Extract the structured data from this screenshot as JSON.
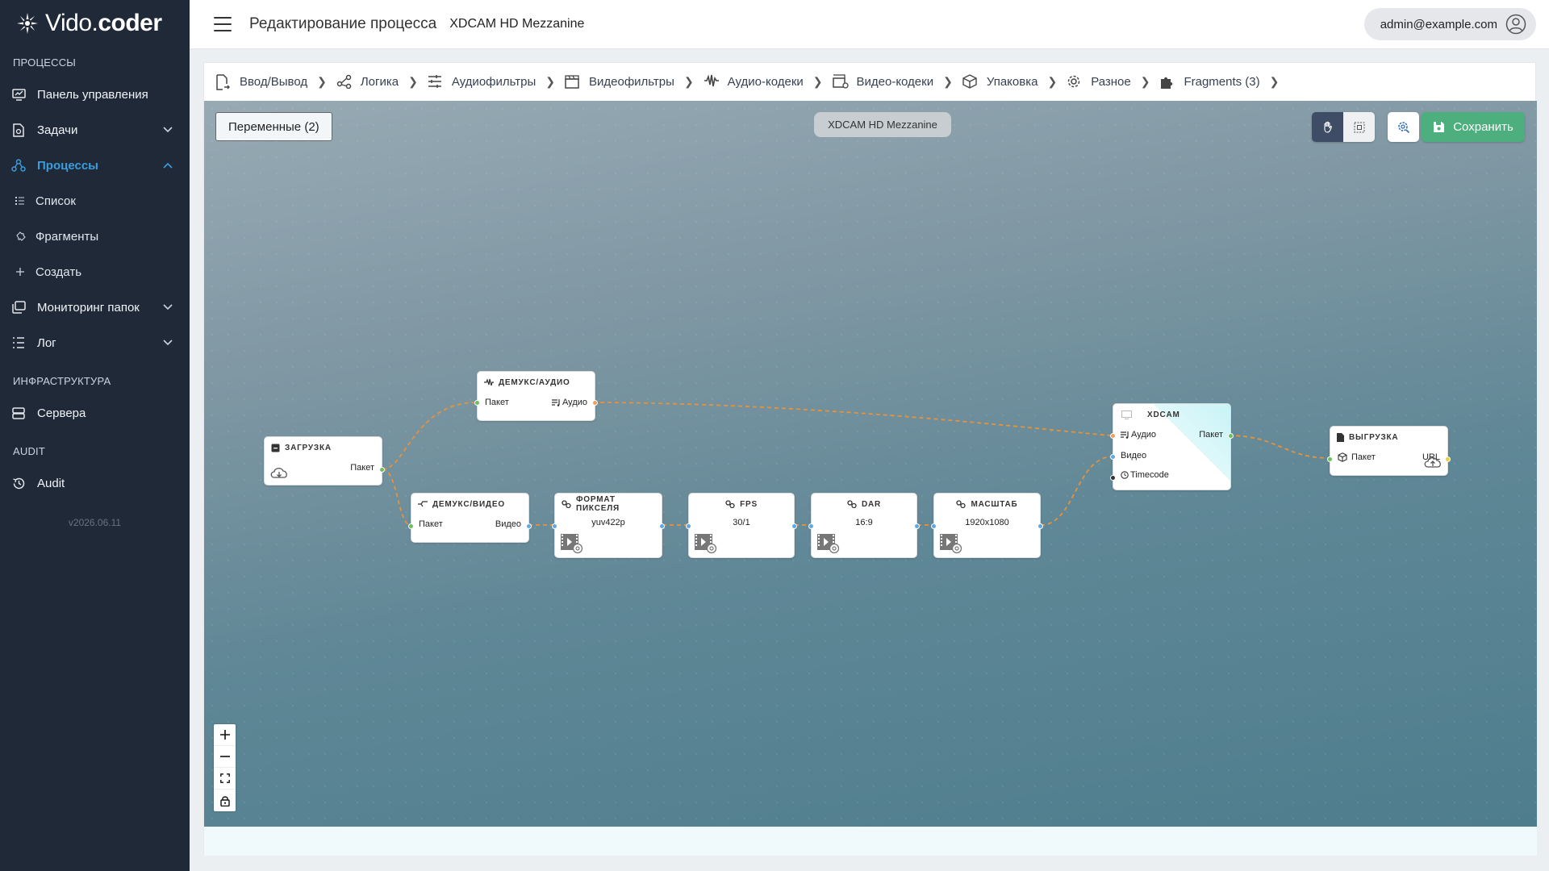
{
  "app": {
    "logo_light": "Vido.",
    "logo_bold": "coder",
    "version": "v2026.06.11"
  },
  "sidebar": {
    "section_processes": "ПРОЦЕССЫ",
    "dashboard": "Панель управления",
    "tasks": "Задачи",
    "processes": "Процессы",
    "list": "Список",
    "fragments": "Фрагменты",
    "create": "Создать",
    "folder_monitoring": "Мониторинг папок",
    "log": "Лог",
    "section_infra": "ИНФРАСТРУКТУРА",
    "servers": "Сервера",
    "section_audit": "AUDIT",
    "audit": "Audit"
  },
  "header": {
    "title": "Редактирование процесса",
    "subtitle": "XDCAM HD Mezzanine",
    "user": "admin@example.com"
  },
  "tabs": [
    {
      "label": "Ввод/Вывод"
    },
    {
      "label": "Логика"
    },
    {
      "label": "Аудиофильтры"
    },
    {
      "label": "Видеофильтры"
    },
    {
      "label": "Аудио-кодеки"
    },
    {
      "label": "Видео-кодеки"
    },
    {
      "label": "Упаковка"
    },
    {
      "label": "Разное"
    },
    {
      "label": "Fragments (3)"
    }
  ],
  "toolbar": {
    "variables": "Переменные (2)",
    "process_label": "XDCAM HD Mezzanine",
    "save": "Сохранить",
    "accent": "#4caf7d"
  },
  "nodes": {
    "load": {
      "title": "Загрузка",
      "out": "Пакет"
    },
    "demux_audio": {
      "title": "Демукс/аудио",
      "in": "Пакет",
      "out": "Аудио"
    },
    "demux_video": {
      "title": "Демукс/видео",
      "in": "Пакет",
      "out": "Видео"
    },
    "pixfmt": {
      "title": "Формат пикселя",
      "value": "yuv422p"
    },
    "fps": {
      "title": "FPS",
      "value": "30/1"
    },
    "dar": {
      "title": "DAR",
      "value": "16:9"
    },
    "scale": {
      "title": "Масштаб",
      "value": "1920x1080"
    },
    "xdcam": {
      "title": "XDCAM",
      "in_audio": "Аудио",
      "in_video": "Видео",
      "in_timecode": "Timecode",
      "out": "Пакет"
    },
    "upload": {
      "title": "Выгрузка",
      "in": "Пакет",
      "out": "URL"
    }
  }
}
